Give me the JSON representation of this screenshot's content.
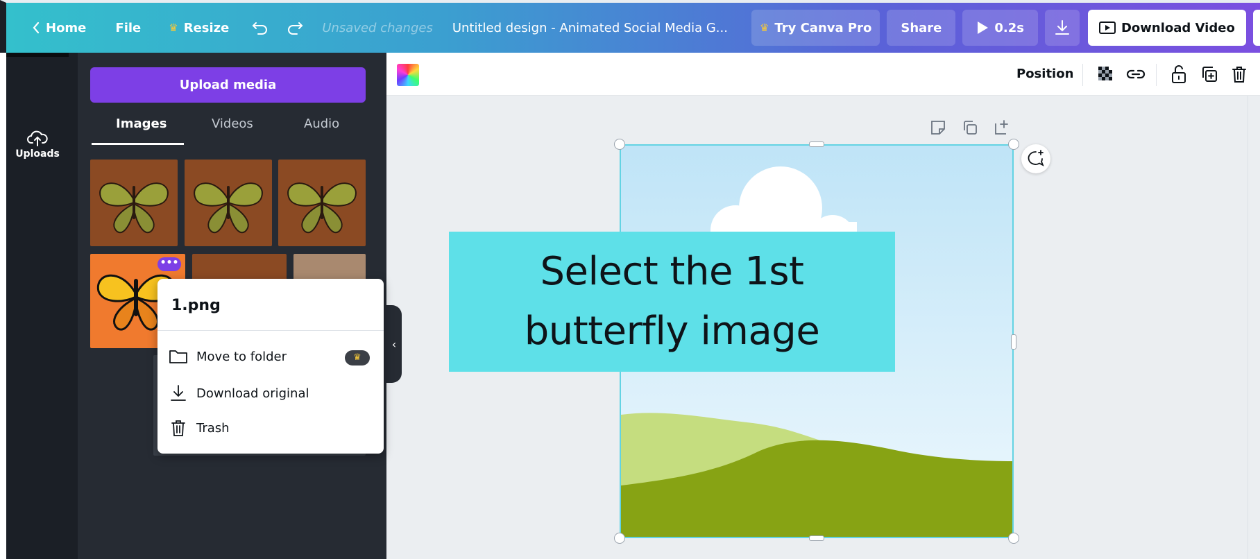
{
  "topbar": {
    "home_label": "Home",
    "file_label": "File",
    "resize_label": "Resize",
    "unsaved_label": "Unsaved changes",
    "doc_title": "Untitled design - Animated Social Media G...",
    "try_pro_label": "Try Canva Pro",
    "share_label": "Share",
    "play_duration": "0.2s",
    "download_video_label": "Download Video",
    "more_label": "•••"
  },
  "rail": {
    "uploads_label": "Uploads"
  },
  "panel": {
    "upload_button_label": "Upload media",
    "tabs": [
      {
        "label": "Images",
        "active": true
      },
      {
        "label": "Videos",
        "active": false
      },
      {
        "label": "Audio",
        "active": false
      }
    ],
    "more_dots": "•••"
  },
  "context_menu": {
    "title": "1.png",
    "items": [
      {
        "label": "Move to folder",
        "icon": "folder-icon",
        "pro": true
      },
      {
        "label": "Download original",
        "icon": "download-icon",
        "pro": false
      },
      {
        "label": "Trash",
        "icon": "trash-icon",
        "pro": false
      }
    ]
  },
  "element_toolbar": {
    "position_label": "Position"
  },
  "canvas": {
    "caption": "Select the 1st butterfly image"
  },
  "colors": {
    "brand_purple": "#7d3fe6",
    "caption_bg": "#5ee0e8",
    "selection_outline": "#63d3e3",
    "panel_bg": "#262b33"
  }
}
